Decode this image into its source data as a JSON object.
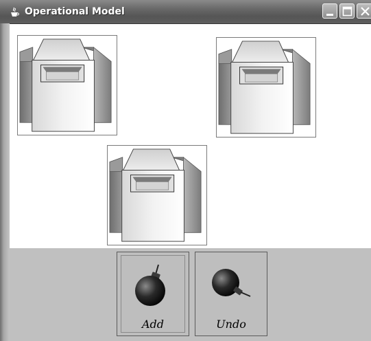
{
  "window": {
    "title": "Operational Model",
    "icons": {
      "app": "java-cup-icon",
      "minimize": "minimize-icon",
      "maximize": "maximize-icon",
      "close": "close-icon"
    }
  },
  "canvas": {
    "machines": [
      {
        "name": "machine",
        "icon": "machine-icon"
      },
      {
        "name": "machine",
        "icon": "machine-icon"
      },
      {
        "name": "machine",
        "icon": "machine-icon"
      }
    ]
  },
  "toolbar": {
    "add_label": "Add",
    "undo_label": "Undo",
    "add_icon": "bomb-icon",
    "undo_icon": "bomb-fuse-icon"
  },
  "colors": {
    "titlebar": "#5e5e5e",
    "toolbar_bg": "#c0c0c0",
    "canvas_bg": "#ffffff"
  }
}
